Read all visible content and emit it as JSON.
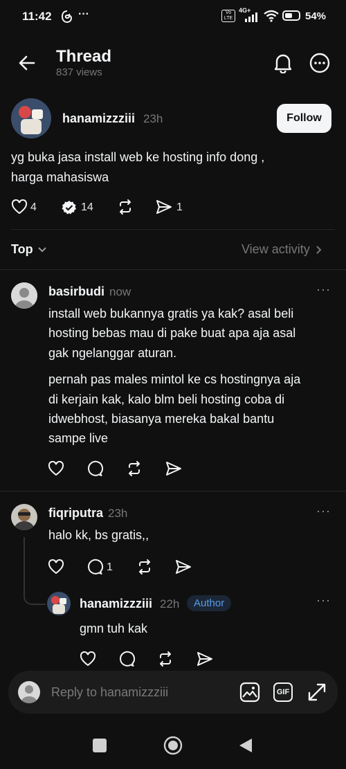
{
  "status_bar": {
    "time": "11:42",
    "carrier_label": "Vo LTE",
    "network": "4G+",
    "battery": "54%"
  },
  "header": {
    "title": "Thread",
    "views": "837 views"
  },
  "post": {
    "username": "hanamizzziii",
    "time": "23h",
    "follow_label": "Follow",
    "text_line1": "yg buka jasa install web ke hosting info dong ,",
    "text_line2": "harga mahasiswa",
    "likes": "4",
    "reposts_count": "14",
    "shares": "1"
  },
  "sort": {
    "label": "Top",
    "view_activity": "View activity"
  },
  "replies": [
    {
      "username": "basirbudi",
      "time": "now",
      "para1": [
        "install web bukannya gratis ya kak? asal beli",
        "hosting bebas mau di pake buat apa aja asal",
        "gak ngelanggar aturan."
      ],
      "para2": [
        "pernah pas males mintol ke cs hostingnya aja",
        "di kerjain kak, kalo blm beli hosting coba di",
        "idwebhost, biasanya mereka bakal bantu",
        "sampe live"
      ]
    },
    {
      "username": "fiqriputra",
      "time": "23h",
      "text": "halo kk, bs gratis,,",
      "replies_count": "1"
    },
    {
      "username": "hanamizzziii",
      "time": "22h",
      "badge": "Author",
      "text": "gmn tuh kak"
    }
  ],
  "reply_bar": {
    "placeholder": "Reply to hanamizzziii",
    "gif_label": "GIF"
  },
  "colors": {
    "background": "#101010",
    "text": "#f3f5f7",
    "muted": "#777777",
    "author_badge": "#5a9be6"
  }
}
